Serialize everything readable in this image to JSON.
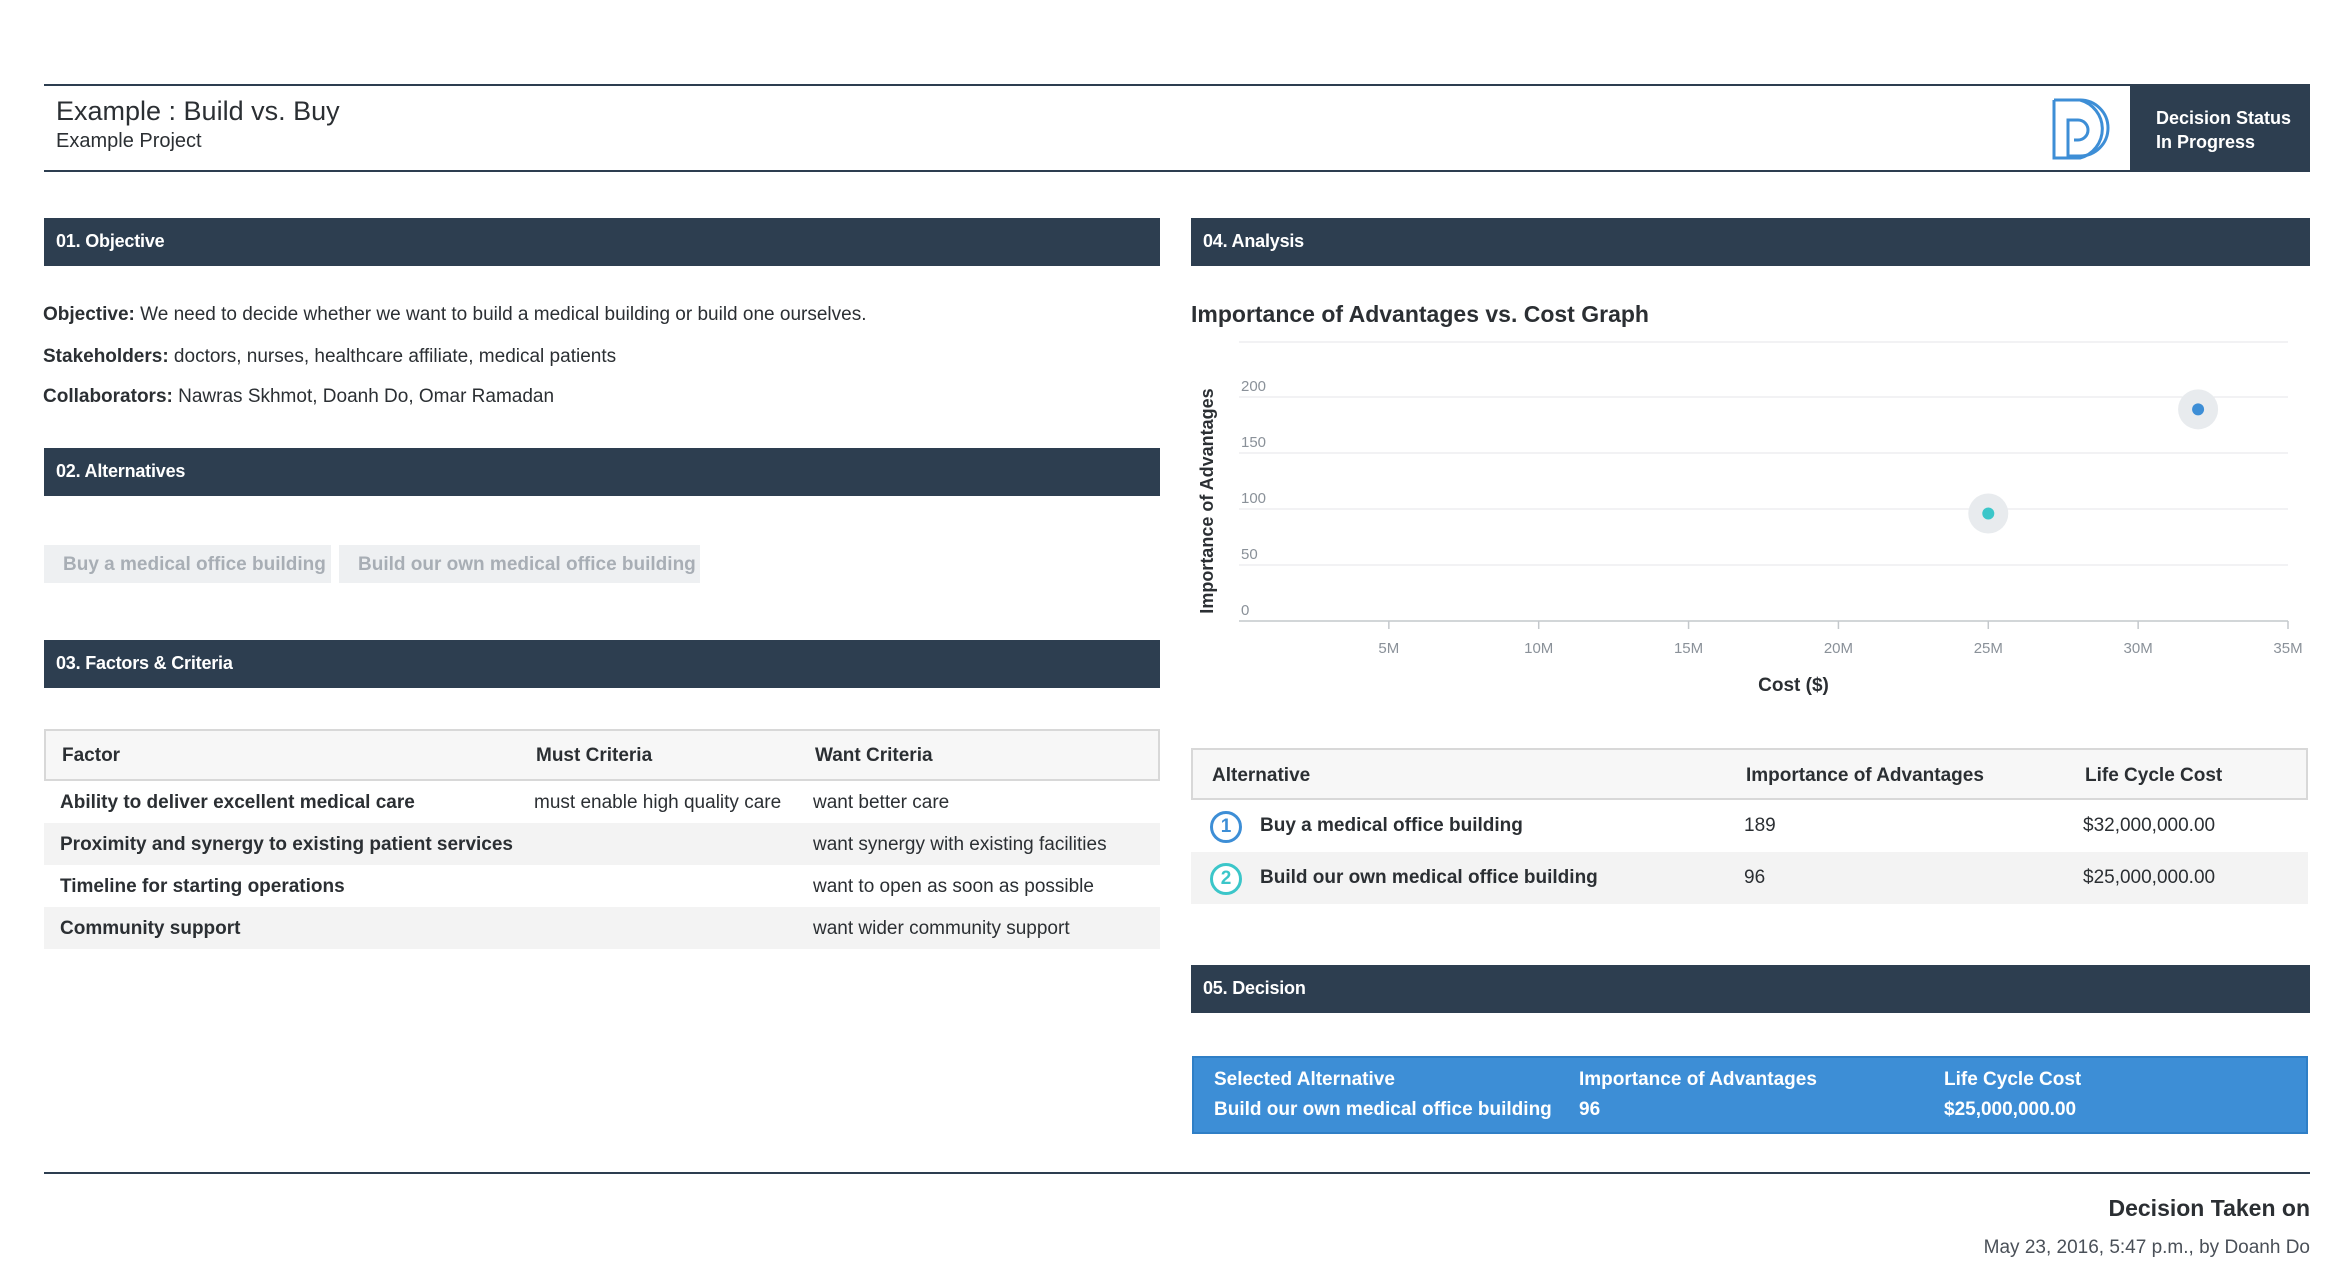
{
  "header": {
    "title": "Example : Build vs. Buy",
    "subtitle": "Example Project",
    "logo_icon": "d-logo-icon",
    "status_label": "Decision Status",
    "status_value": "In Progress"
  },
  "sections": {
    "objective": "01. Objective",
    "alternatives": "02. Alternatives",
    "factors": "03. Factors & Criteria",
    "analysis": "04. Analysis",
    "decision": "05. Decision"
  },
  "objective": {
    "objective_label": "Objective:",
    "objective_text": " We need to decide whether we want to build a medical building or build one ourselves.",
    "stakeholders_label": "Stakeholders:",
    "stakeholders_text": " doctors, nurses, healthcare affiliate, medical patients",
    "collaborators_label": "Collaborators:",
    "collaborators_text": " Nawras Skhmot, Doanh Do, Omar Ramadan"
  },
  "alternatives": [
    "Buy a medical office building",
    "Build our own medical office building"
  ],
  "factors_table": {
    "headers": [
      "Factor",
      "Must Criteria",
      "Want Criteria"
    ],
    "rows": [
      [
        "Ability to deliver excellent medical care",
        "must enable high quality care",
        "want better care"
      ],
      [
        "Proximity and synergy to existing patient services",
        "",
        "want synergy with existing facilities"
      ],
      [
        "Timeline for starting operations",
        "",
        "want to open as soon as possible"
      ],
      [
        "Community support",
        "",
        "want wider community support"
      ]
    ]
  },
  "chart_data": {
    "type": "scatter",
    "title": "Importance of Advantages vs. Cost Graph",
    "xlabel": "Cost ($)",
    "ylabel": "Importance of Advantages",
    "x_ticks": [
      "5M",
      "10M",
      "15M",
      "20M",
      "25M",
      "30M",
      "35M"
    ],
    "y_ticks": [
      "0",
      "50",
      "100",
      "150",
      "200"
    ],
    "xlim": [
      0,
      35000000
    ],
    "ylim": [
      0,
      200
    ],
    "grid": true,
    "series": [
      {
        "x": [
          32000000
        ],
        "y": [
          189
        ],
        "color": "#3d8ed6"
      },
      {
        "x": [
          25000000
        ],
        "y": [
          96
        ],
        "color": "#3bc6c9"
      }
    ]
  },
  "analysis_table": {
    "headers": [
      "Alternative",
      "Importance of Advantages",
      "Life Cycle Cost"
    ],
    "rows": [
      {
        "num": "1",
        "name": "Buy a medical office building",
        "importance": "189",
        "cost": "$32,000,000.00",
        "color": "#3d8ed6"
      },
      {
        "num": "2",
        "name": "Build our own medical office building",
        "importance": "96",
        "cost": "$25,000,000.00",
        "color": "#3bc6c9"
      }
    ]
  },
  "decision": {
    "selected_label": "Selected Alternative",
    "selected_value": "Build our own medical office building",
    "importance_label": "Importance of Advantages",
    "importance_value": "96",
    "cost_label": "Life Cycle Cost",
    "cost_value": "$25,000,000.00"
  },
  "footer": {
    "taken_label": "Decision Taken on",
    "taken_value": "May 23, 2016, 5:47 p.m., by Doanh Do"
  }
}
